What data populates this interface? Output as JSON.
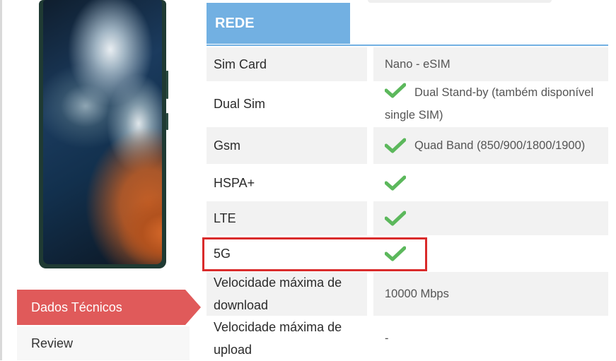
{
  "nav": {
    "active_label": "Dados Técnicos",
    "next_label": "Review"
  },
  "section": {
    "title": "REDE",
    "accent_color": "#72b0e2"
  },
  "specs": [
    {
      "label": "Sim Card",
      "value": "Nano - eSIM",
      "check": false
    },
    {
      "label": "Dual Sim",
      "value": "Dual Stand-by (também disponível single SIM)",
      "check": true
    },
    {
      "label": "Gsm",
      "value": "Quad Band (850/900/1800/1900)",
      "check": true
    },
    {
      "label": "HSPA+",
      "value": "",
      "check": true
    },
    {
      "label": "LTE",
      "value": "",
      "check": true
    },
    {
      "label": "5G",
      "value": "",
      "check": true
    },
    {
      "label": "Velocidade máxima de download",
      "value": "10000 Mbps",
      "check": false
    },
    {
      "label": "Velocidade máxima de upload",
      "value": "-",
      "check": false
    }
  ],
  "colors": {
    "check": "#5cb85c",
    "nav_active": "#e05a5a",
    "highlight": "#d92b2b"
  },
  "icons": {
    "check": "check-icon"
  }
}
